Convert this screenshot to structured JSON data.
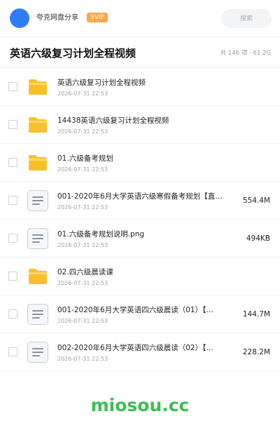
{
  "header": {
    "share_name": "夸克网盘分享",
    "badge": "SVIP",
    "search_placeholder": "搜索"
  },
  "folder": {
    "title": "英语六级复习计划全程视频",
    "summary": "共 146 项 · 61.2G"
  },
  "colors": {
    "accent": "#2f7df6",
    "badge": "#f6a84a",
    "folder": "#f8c12c",
    "watermark": "#3cbf50"
  },
  "items": [
    {
      "type": "folder",
      "icon": "folder-icon",
      "name": "英语六级复习计划全程视频",
      "date": "2026-07-31 22:53",
      "size": ""
    },
    {
      "type": "folder",
      "icon": "folder-icon",
      "name": "14438英语六级复习计划全程视频",
      "date": "2026-07-31 22:53",
      "size": ""
    },
    {
      "type": "folder",
      "icon": "folder-icon",
      "name": "01.六级备考规划",
      "date": "2026-07-31 22:53",
      "size": ""
    },
    {
      "type": "file",
      "icon": "document-icon",
      "name": "001-2020年6月大学英语六级寒假备考规划【直…",
      "date": "2026-07-31 22:53",
      "size": "554.4M"
    },
    {
      "type": "file",
      "icon": "document-icon",
      "name": "01.六级备考规划说明.png",
      "date": "2026-07-31 22:53",
      "size": "494KB"
    },
    {
      "type": "folder",
      "icon": "folder-icon",
      "name": "02.四六级晨读课",
      "date": "2026-07-31 22:53",
      "size": ""
    },
    {
      "type": "file",
      "icon": "document-icon",
      "name": "001-2020年6月大学英语四六级晨读（01）【…",
      "date": "2026-07-31 22:53",
      "size": "144.7M"
    },
    {
      "type": "file",
      "icon": "document-icon",
      "name": "002-2020年6月大学英语四六级晨读（02）【…",
      "date": "2026-07-31 22:53",
      "size": "228.2M"
    }
  ],
  "watermark": "miosou.cc"
}
